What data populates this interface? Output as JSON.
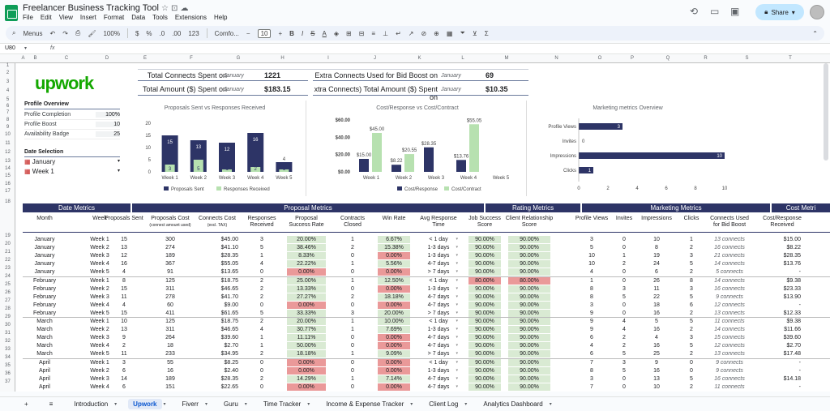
{
  "app": {
    "title": "Freelancer Business Tracking Tool",
    "menus": [
      "File",
      "Edit",
      "View",
      "Insert",
      "Format",
      "Data",
      "Tools",
      "Extensions",
      "Help"
    ],
    "share": "Share"
  },
  "toolbar": {
    "menus": "Menus",
    "zoom": "100%",
    "currency": "$",
    "percent": "%",
    "dec_dec": ".0",
    "dec_inc": ".00",
    "format123": "123",
    "font": "Comfo...",
    "fontsize": "10"
  },
  "formula": {
    "cell": "U80",
    "fx": "fx"
  },
  "columns": [
    "A",
    "B",
    "C",
    "D",
    "E",
    "F",
    "G",
    "H",
    "I",
    "J",
    "K",
    "L",
    "M",
    "N",
    "O",
    "P",
    "Q",
    "R",
    "S",
    "T"
  ],
  "rows": [
    "1",
    "2",
    "3",
    "4",
    "5",
    "6",
    "7",
    "8",
    "9",
    "10",
    "11",
    "12",
    "13",
    "14",
    "15",
    "16",
    "17",
    "18",
    "19",
    "20",
    "21",
    "22",
    "23",
    "24",
    "25",
    "26",
    "27",
    "28",
    "29",
    "30",
    "31",
    "32",
    "33",
    "34",
    "35",
    "36",
    "37"
  ],
  "brand": "upwork",
  "summary": {
    "l1": "Total Connects Spent on",
    "m1": "January",
    "v1": "1221",
    "l2": "Total Amount ($) Spent on",
    "m2": "January",
    "v2": "$183.15",
    "l3": "Extra Connects Used for Bid Boost on",
    "m3": "January",
    "v3": "69",
    "l4": "xtra Connects) Total Amount ($) Spent on",
    "m4": "January",
    "v4": "$10.35"
  },
  "profile": {
    "title": "Profile Overview",
    "items": [
      {
        "label": "Profile Completion",
        "value": "100%"
      },
      {
        "label": "Profile Boost",
        "value": "10"
      },
      {
        "label": "Availability Badge",
        "value": "25"
      }
    ],
    "date_title": "Date Selection",
    "month": "January",
    "week": "Week 1"
  },
  "chart_data": [
    {
      "type": "bar",
      "title": "Proposals Sent vs Responses Received",
      "categories": [
        "Week 1",
        "Week 2",
        "Week 3",
        "Week 4",
        "Week 5"
      ],
      "series": [
        {
          "name": "Proposals Sent",
          "values": [
            15,
            13,
            12,
            16,
            4
          ]
        },
        {
          "name": "Responses Received",
          "values": [
            3,
            5,
            1,
            2,
            1
          ]
        }
      ],
      "ylim": [
        0,
        20
      ],
      "yticks": [
        "20",
        "15",
        "10",
        "5",
        "0"
      ],
      "colors": [
        "#2d3466",
        "#b7e1b0"
      ]
    },
    {
      "type": "bar",
      "title": "Cost/Response vs Cost/Contract",
      "categories": [
        "Week 1",
        "Week 2",
        "Week 3",
        "Week 4",
        "Week 5"
      ],
      "series": [
        {
          "name": "Cost/Response",
          "values": [
            15.0,
            8.22,
            28.35,
            13.76,
            0
          ]
        },
        {
          "name": "Cost/Contract",
          "values": [
            45.0,
            20.55,
            0,
            55.05,
            0
          ]
        }
      ],
      "labels1": [
        "$15.00",
        "$8.22",
        "$28.35",
        "$13.76",
        ""
      ],
      "labels2": [
        "$45.00",
        "$20.55",
        "",
        "$55.05",
        ""
      ],
      "ylim": [
        0,
        60
      ],
      "yticks": [
        "$60.00",
        "$40.00",
        "$20.00",
        "$0.00"
      ],
      "colors": [
        "#2d3466",
        "#b7e1b0"
      ]
    },
    {
      "type": "bar",
      "title": "Marketing metrics Overview",
      "categories": [
        "Profile Views",
        "Invites",
        "Impressions",
        "Clicks"
      ],
      "values": [
        3,
        0,
        10,
        1
      ],
      "xlim": [
        0,
        10
      ],
      "xticks": [
        "0",
        "2",
        "4",
        "6",
        "8",
        "10"
      ],
      "colors": [
        "#2d3466"
      ]
    }
  ],
  "table": {
    "groups": [
      "Date Metrics",
      "Proposal Metrics",
      "Rating Metrics",
      "Marketing Metrics",
      "Cost Metri"
    ],
    "headers": [
      "Month",
      "Week",
      "Proposals Sent",
      "Proposals Cost",
      "(connect amount used)",
      "Connects Cost",
      "(excl. TAX)",
      "Responses",
      "Received",
      "Proposal",
      "Success Rate",
      "Contracts",
      "Closed",
      "Win Rate",
      "Avg Response",
      "Time",
      "Job Success",
      "Score",
      "Client Relationship",
      "Score",
      "Profile Views",
      "Invites",
      "Impressions",
      "Clicks",
      "Connects Used",
      "for Bid Boost",
      "Cost/Response",
      "Received"
    ],
    "rows": [
      [
        "January",
        "Week 1",
        "15",
        "300",
        "$45.00",
        "3",
        "20.00%",
        "1",
        "6.67%",
        "< 1 day",
        "90.00%",
        "90.00%",
        "3",
        "0",
        "10",
        "1",
        "13 connects",
        "$15.00"
      ],
      [
        "January",
        "Week 2",
        "13",
        "274",
        "$41.10",
        "5",
        "38.46%",
        "2",
        "15.38%",
        "1-3 days",
        "90.00%",
        "90.00%",
        "5",
        "0",
        "8",
        "2",
        "16 connects",
        "$8.22"
      ],
      [
        "January",
        "Week 3",
        "12",
        "189",
        "$28.35",
        "1",
        "8.33%",
        "0",
        "0.00%",
        "1-3 days",
        "90.00%",
        "90.00%",
        "10",
        "1",
        "19",
        "3",
        "21 connects",
        "$28.35"
      ],
      [
        "January",
        "Week 4",
        "16",
        "367",
        "$55.05",
        "4",
        "22.22%",
        "1",
        "5.56%",
        "4-7 days",
        "90.00%",
        "90.00%",
        "10",
        "2",
        "24",
        "5",
        "14 connects",
        "$13.76"
      ],
      [
        "January",
        "Week 5",
        "4",
        "91",
        "$13.65",
        "0",
        "0.00%",
        "0",
        "0.00%",
        "> 7 days",
        "90.00%",
        "90.00%",
        "4",
        "0",
        "6",
        "2",
        "5 connects",
        "-"
      ],
      [
        "February",
        "Week 1",
        "8",
        "125",
        "$18.75",
        "2",
        "25.00%",
        "1",
        "12.50%",
        "< 1 day",
        "80.00%",
        "80.00%",
        "1",
        "0",
        "26",
        "8",
        "14 connects",
        "$9.38"
      ],
      [
        "February",
        "Week 2",
        "15",
        "311",
        "$46.65",
        "2",
        "13.33%",
        "0",
        "0.00%",
        "1-3 days",
        "90.00%",
        "90.00%",
        "8",
        "3",
        "11",
        "3",
        "16 connects",
        "$23.33"
      ],
      [
        "February",
        "Week 3",
        "11",
        "278",
        "$41.70",
        "2",
        "27.27%",
        "2",
        "18.18%",
        "4-7 days",
        "90.00%",
        "90.00%",
        "8",
        "5",
        "22",
        "5",
        "9 connects",
        "$13.90"
      ],
      [
        "February",
        "Week 4",
        "4",
        "60",
        "$9.00",
        "0",
        "0.00%",
        "0",
        "0.00%",
        "4-7 days",
        "90.00%",
        "90.00%",
        "3",
        "0",
        "18",
        "6",
        "12 connects",
        "-"
      ],
      [
        "February",
        "Week 5",
        "15",
        "411",
        "$61.65",
        "5",
        "33.33%",
        "3",
        "20.00%",
        "> 7 days",
        "90.00%",
        "90.00%",
        "9",
        "0",
        "16",
        "2",
        "13 connects",
        "$12.33"
      ],
      [
        "March",
        "Week 1",
        "10",
        "125",
        "$18.75",
        "2",
        "20.00%",
        "1",
        "10.00%",
        "< 1 day",
        "90.00%",
        "90.00%",
        "9",
        "4",
        "5",
        "5",
        "11 connects",
        "$9.38"
      ],
      [
        "March",
        "Week 2",
        "13",
        "311",
        "$46.65",
        "4",
        "30.77%",
        "1",
        "7.69%",
        "1-3 days",
        "90.00%",
        "90.00%",
        "9",
        "4",
        "16",
        "2",
        "14 connects",
        "$11.66"
      ],
      [
        "March",
        "Week 3",
        "9",
        "264",
        "$39.60",
        "1",
        "11.11%",
        "0",
        "0.00%",
        "4-7 days",
        "90.00%",
        "90.00%",
        "6",
        "2",
        "4",
        "3",
        "15 connects",
        "$39.60"
      ],
      [
        "March",
        "Week 4",
        "2",
        "18",
        "$2.70",
        "1",
        "50.00%",
        "0",
        "0.00%",
        "4-7 days",
        "90.00%",
        "90.00%",
        "4",
        "2",
        "16",
        "5",
        "12 connects",
        "$2.70"
      ],
      [
        "March",
        "Week 5",
        "11",
        "233",
        "$34.95",
        "2",
        "18.18%",
        "1",
        "9.09%",
        "> 7 days",
        "90.00%",
        "90.00%",
        "6",
        "5",
        "25",
        "2",
        "13 connects",
        "$17.48"
      ],
      [
        "April",
        "Week 1",
        "3",
        "55",
        "$8.25",
        "0",
        "0.00%",
        "0",
        "0.00%",
        "< 1 day",
        "90.00%",
        "90.00%",
        "7",
        "3",
        "9",
        "0",
        "9 connects",
        "-"
      ],
      [
        "April",
        "Week 2",
        "6",
        "16",
        "$2.40",
        "0",
        "0.00%",
        "0",
        "0.00%",
        "1-3 days",
        "90.00%",
        "90.00%",
        "8",
        "5",
        "16",
        "0",
        "9 connects",
        "-"
      ],
      [
        "April",
        "Week 3",
        "14",
        "189",
        "$28.35",
        "2",
        "14.29%",
        "1",
        "7.14%",
        "4-7 days",
        "90.00%",
        "90.00%",
        "3",
        "0",
        "13",
        "5",
        "16 connects",
        "$14.18"
      ],
      [
        "April",
        "Week 4",
        "6",
        "151",
        "$22.65",
        "0",
        "0.00%",
        "0",
        "0.00%",
        "4-7 days",
        "90.00%",
        "90.00%",
        "7",
        "0",
        "10",
        "2",
        "11 connects",
        "-"
      ]
    ]
  },
  "tabs": [
    "+",
    "≡",
    "Introduction",
    "Upwork",
    "Fiverr",
    "Guru",
    "Time Tracker",
    "Income & Expense Tracker",
    "Client Log",
    "Analytics Dashboard"
  ]
}
